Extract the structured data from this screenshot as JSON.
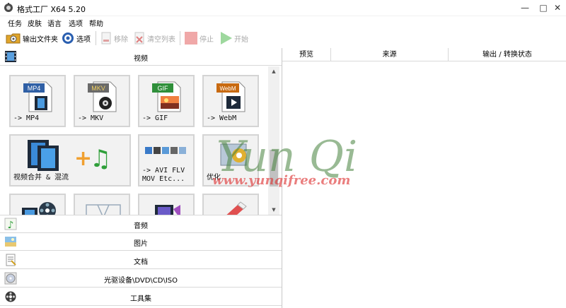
{
  "window": {
    "title": "格式工厂 X64 5.20",
    "minimize": "—",
    "maximize": "□",
    "close": "✕"
  },
  "menu": [
    "任务",
    "皮肤",
    "语言",
    "选项",
    "帮助"
  ],
  "toolbar": {
    "output_folder": "输出文件夹",
    "options": "选项",
    "remove": "移除",
    "clear_list": "清空列表",
    "stop": "停止",
    "start": "开始"
  },
  "categories": {
    "video": "视频",
    "audio": "音频",
    "picture": "图片",
    "document": "文档",
    "optical": "光驱设备\\DVD\\CD\\ISO",
    "tools": "工具集"
  },
  "tiles": {
    "mp4": {
      "badge": "MP4",
      "label": "-> MP4"
    },
    "mkv": {
      "badge": "MKV",
      "label": "-> MKV"
    },
    "gif": {
      "badge": "GIF",
      "label": "-> GIF"
    },
    "webm": {
      "badge": "WebM",
      "label": "-> WebM"
    },
    "merge": {
      "label": "视频合并 & 混流"
    },
    "avi": {
      "label1": "-> AVI FLV",
      "label2": "MOV Etc..."
    },
    "optimize": {
      "label": "优化"
    }
  },
  "task_columns": {
    "preview": "预览",
    "source": "来源",
    "status": "输出 / 转换状态"
  },
  "watermark": {
    "logo": "Yun Qi",
    "url": "www.yunqifree.com"
  },
  "colors": {
    "mp4_badge": "#2f5fa5",
    "mkv_badge": "#6a6a6a",
    "gif_badge": "#2f8f3a",
    "webm_badge": "#c86a10",
    "watermark": "#d63030",
    "stop": "#f0a8a8",
    "start": "#9ed89e"
  }
}
